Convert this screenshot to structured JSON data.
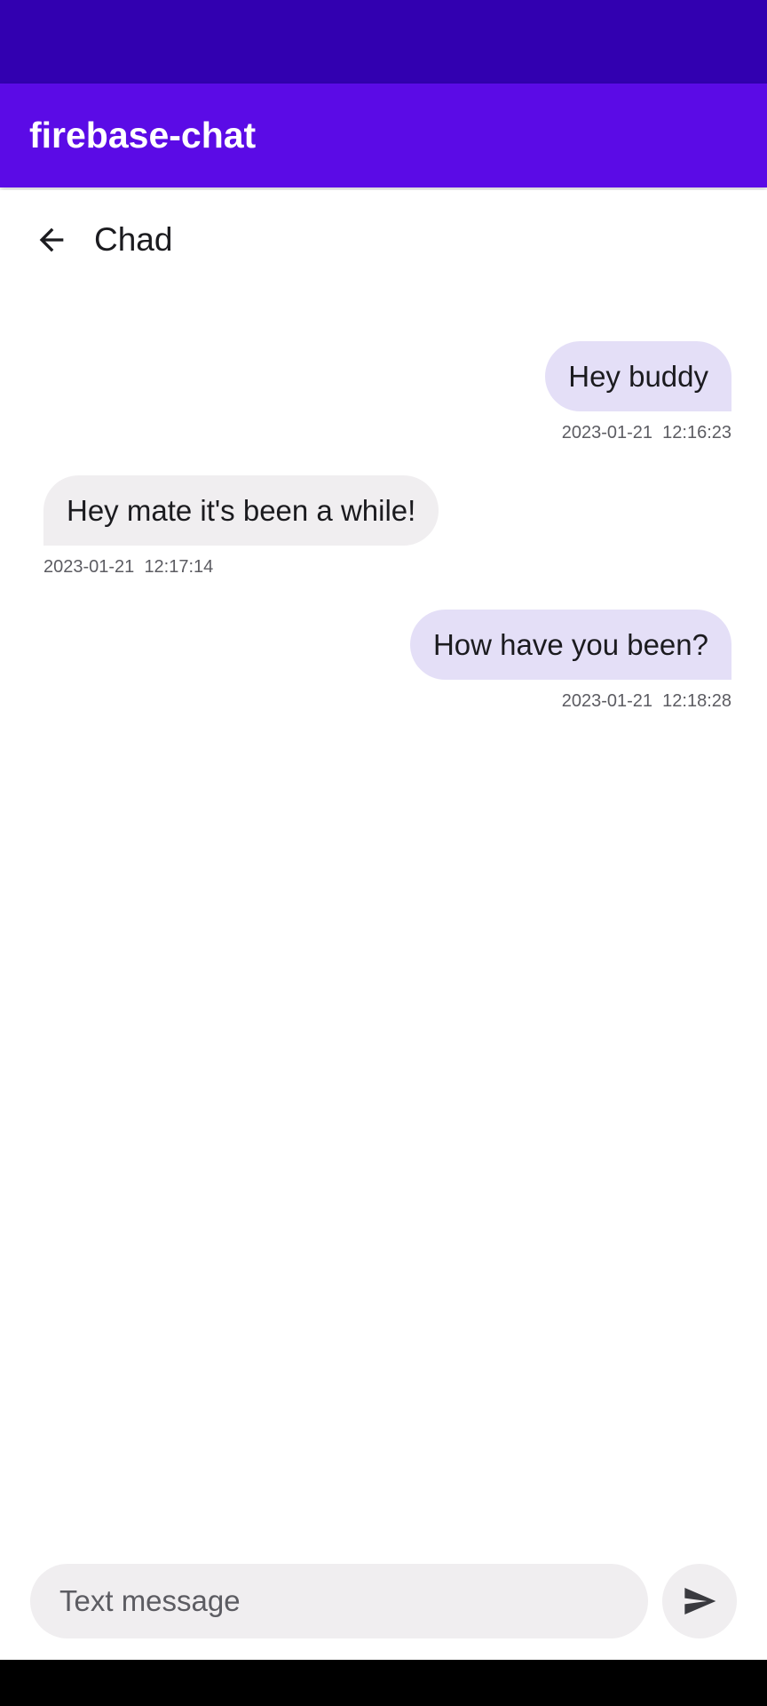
{
  "app": {
    "title": "firebase-chat"
  },
  "chat": {
    "contact_name": "Chad",
    "back_icon": "arrow-back-icon"
  },
  "messages": [
    {
      "direction": "sent",
      "text": "Hey buddy",
      "date": "2023-01-21",
      "time": "12:16:23"
    },
    {
      "direction": "received",
      "text": "Hey mate it's been a while!",
      "date": "2023-01-21",
      "time": "12:17:14"
    },
    {
      "direction": "sent",
      "text": "How have you been?",
      "date": "2023-01-21",
      "time": "12:18:28"
    }
  ],
  "composer": {
    "placeholder": "Text message",
    "value": "",
    "send_icon": "send-icon"
  },
  "colors": {
    "status_bar": "#3200b0",
    "app_bar": "#5b0be6",
    "sent_bubble": "#e4dff7",
    "received_bubble": "#f0eef0",
    "input_background": "#f0eef0",
    "nav_bar": "#000000"
  }
}
